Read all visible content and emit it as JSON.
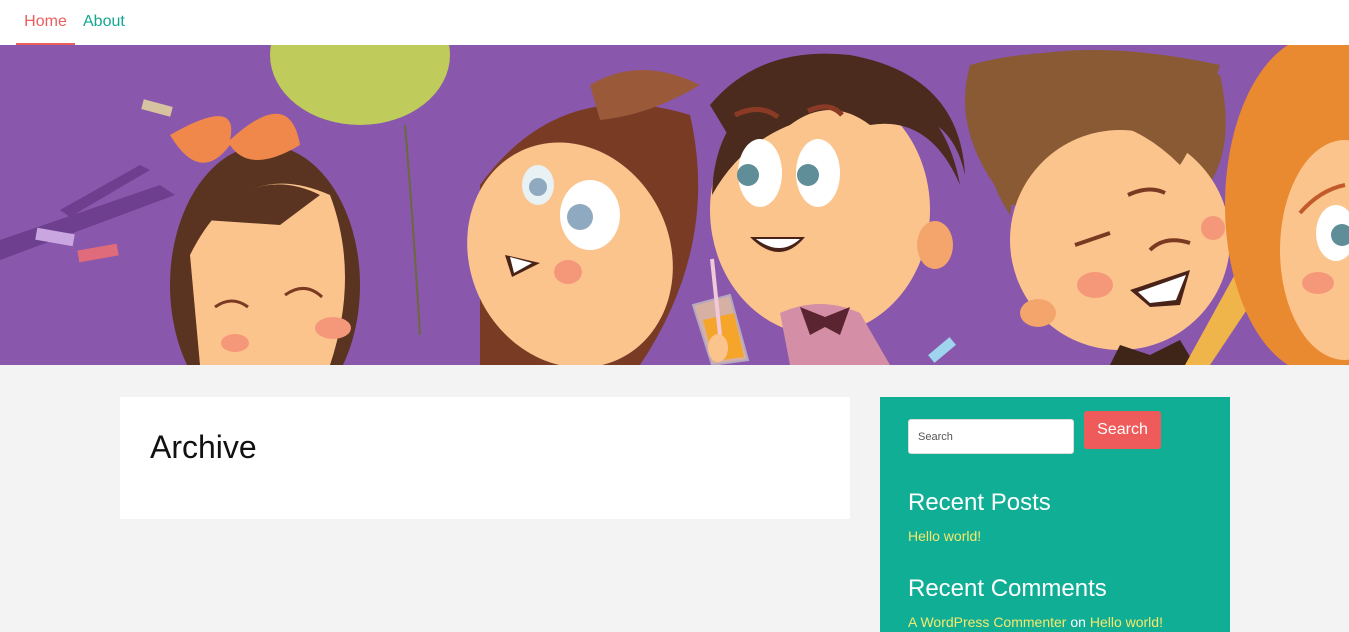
{
  "nav": {
    "home": "Home",
    "about": "About"
  },
  "header_image": "cartoon children party illustration",
  "archive": {
    "title": "Archive"
  },
  "sidebar": {
    "search_placeholder": "Search",
    "search_button": "Search",
    "recent_posts": {
      "title": "Recent Posts",
      "items": [
        "Hello world!"
      ]
    },
    "recent_comments": {
      "title": "Recent Comments",
      "author": "A WordPress Commenter",
      "connector": "on",
      "post": "Hello world!"
    }
  },
  "colors": {
    "accent_red": "#ea5e5e",
    "accent_teal": "#12a88f",
    "sidebar_bg": "#11ae96",
    "link_yellow": "#f5e96b",
    "hero_purple": "#8f5ab0"
  }
}
